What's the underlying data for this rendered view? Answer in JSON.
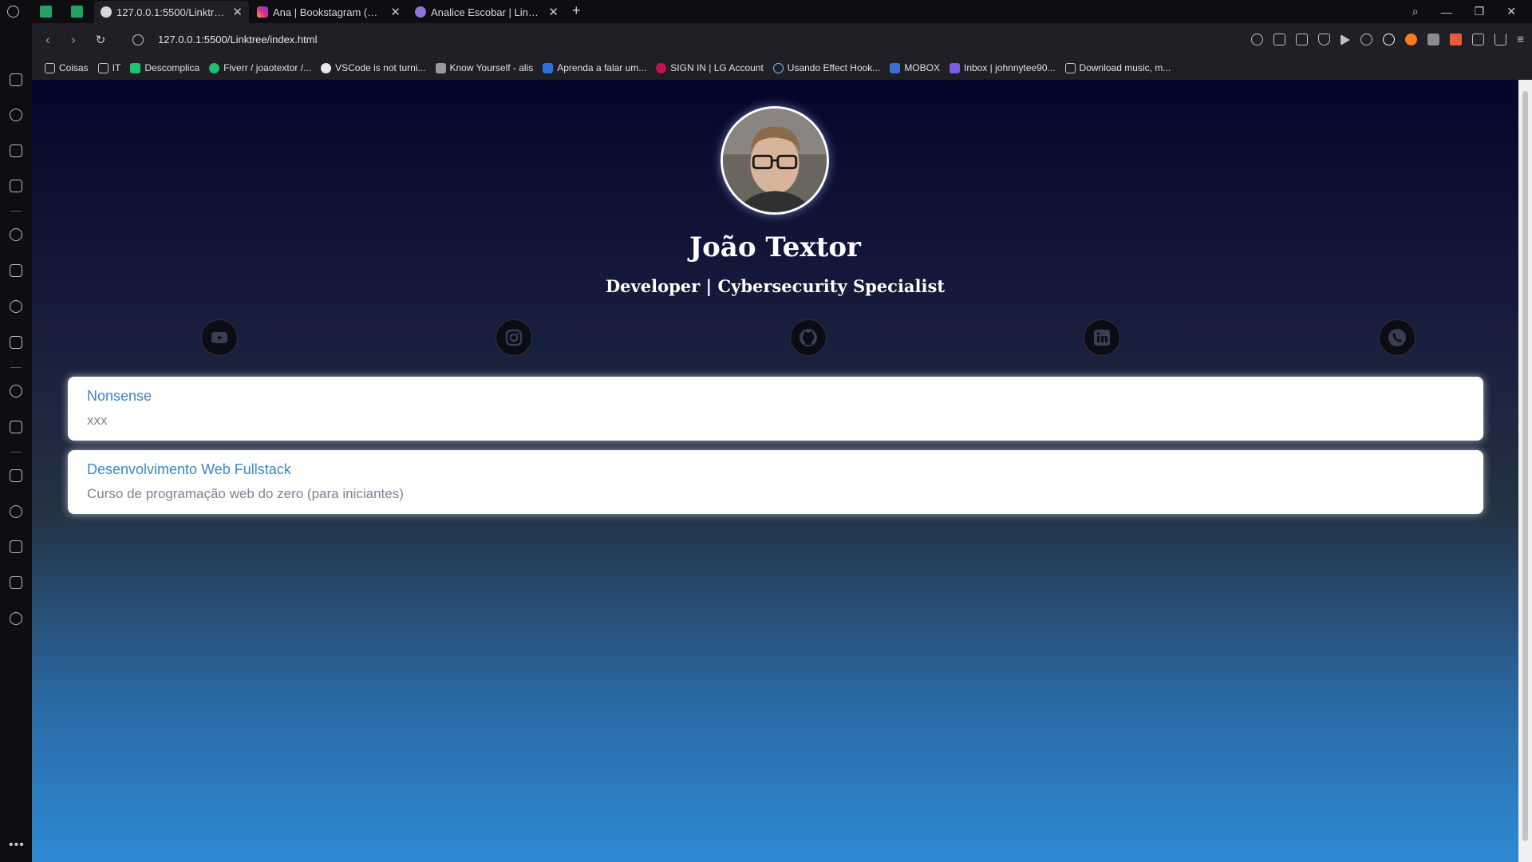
{
  "browser": {
    "tabs": [
      {
        "title": "127.0.0.1:5500/Linktree/ind",
        "active": true
      },
      {
        "title": "Ana | Bookstagram (@mid",
        "active": false
      },
      {
        "title": "Analice Escobar | Linkr.Bio",
        "active": false
      }
    ],
    "new_tab": "+",
    "url": "127.0.0.1:5500/Linktree/index.html",
    "bookmarks": [
      "Coisas",
      "IT",
      "Descomplica",
      "Fiverr / joaotextor /...",
      "VSCode is not turni...",
      "Know Yourself - alis",
      "Aprenda a falar um...",
      "SIGN IN | LG Account",
      "Usando Effect Hook...",
      "MOBOX",
      "Inbox | johnnytee90...",
      "Download music, m..."
    ]
  },
  "profile": {
    "name": "João Textor",
    "role": "Developer | Cybersecurity Specialist"
  },
  "social": [
    "youtube-icon",
    "instagram-icon",
    "github-icon",
    "linkedin-icon",
    "phone-icon"
  ],
  "links": [
    {
      "title": "Nonsense",
      "description": "xxx"
    },
    {
      "title": "Desenvolvimento Web Fullstack",
      "description": "Curso de programação web do zero (para iniciantes)"
    }
  ],
  "colors": {
    "link_title": "#3a86c8",
    "link_desc": "#8b7b95",
    "gradient_top": "#04052a",
    "gradient_bottom": "#2e8ad4"
  }
}
